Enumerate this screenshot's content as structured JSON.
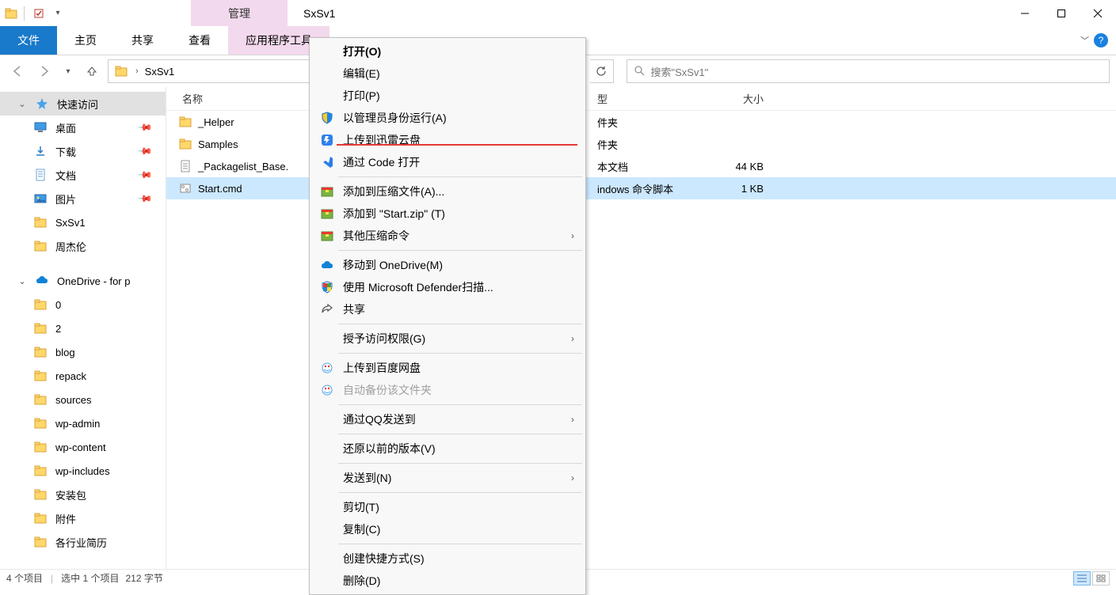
{
  "titlebar": {
    "context_tab": "管理",
    "title": "SxSv1"
  },
  "ribbon": {
    "file": "文件",
    "home": "主页",
    "share": "共享",
    "view": "查看",
    "apptools": "应用程序工具"
  },
  "addr": {
    "path": "SxSv1"
  },
  "search": {
    "placeholder": "搜索\"SxSv1\""
  },
  "sidebar": {
    "quick_access": "快速访问",
    "quick": [
      {
        "label": "桌面",
        "glyph": "monitor"
      },
      {
        "label": "下载",
        "glyph": "download"
      },
      {
        "label": "文档",
        "glyph": "doc"
      },
      {
        "label": "图片",
        "glyph": "picture"
      },
      {
        "label": "SxSv1",
        "glyph": "folder",
        "nopin": true
      },
      {
        "label": "周杰伦",
        "glyph": "folder",
        "nopin": true
      }
    ],
    "onedrive": "OneDrive - for p",
    "onedrive_items": [
      "0",
      "2",
      "blog",
      "repack",
      "sources",
      "wp-admin",
      "wp-content",
      "wp-includes",
      "安装包",
      "附件",
      "各行业简历"
    ]
  },
  "columns": {
    "name": "名称",
    "type": "型",
    "size": "大小"
  },
  "files": [
    {
      "name": "_Helper",
      "type": "件夹",
      "size": "",
      "icon": "folder"
    },
    {
      "name": "Samples",
      "type": "件夹",
      "size": "",
      "icon": "folder"
    },
    {
      "name": "_Packagelist_Base.",
      "type": "本文档",
      "size": "44 KB",
      "icon": "txt"
    },
    {
      "name": "Start.cmd",
      "type": "indows 命令脚本",
      "size": "1 KB",
      "icon": "cmd",
      "selected": true
    }
  ],
  "ctx": [
    {
      "label": "打开(O)",
      "default": true
    },
    {
      "label": "编辑(E)"
    },
    {
      "label": "打印(P)"
    },
    {
      "label": "以管理员身份运行(A)",
      "icon": "shield"
    },
    {
      "label": "上传到迅雷云盘",
      "icon": "xunlei"
    },
    {
      "label": "通过 Code 打开",
      "icon": "vscode"
    },
    {
      "sep": true
    },
    {
      "label": "添加到压缩文件(A)...",
      "icon": "archive"
    },
    {
      "label": "添加到 \"Start.zip\" (T)",
      "icon": "archive"
    },
    {
      "label": "其他压缩命令",
      "icon": "archive",
      "sub": true
    },
    {
      "sep": true
    },
    {
      "label": "移动到 OneDrive(M)",
      "icon": "onedrive"
    },
    {
      "label": "使用 Microsoft Defender扫描...",
      "icon": "defender"
    },
    {
      "label": "共享",
      "icon": "share"
    },
    {
      "sep": true
    },
    {
      "label": "授予访问权限(G)",
      "sub": true
    },
    {
      "sep": true
    },
    {
      "label": "上传到百度网盘",
      "icon": "baidu"
    },
    {
      "label": "自动备份该文件夹",
      "icon": "baidu",
      "disabled": true
    },
    {
      "sep": true
    },
    {
      "label": "通过QQ发送到",
      "sub": true
    },
    {
      "sep": true
    },
    {
      "label": "还原以前的版本(V)"
    },
    {
      "sep": true
    },
    {
      "label": "发送到(N)",
      "sub": true
    },
    {
      "sep": true
    },
    {
      "label": "剪切(T)"
    },
    {
      "label": "复制(C)"
    },
    {
      "sep": true
    },
    {
      "label": "创建快捷方式(S)"
    },
    {
      "label": "删除(D)"
    }
  ],
  "status": {
    "count": "4 个项目",
    "selected": "选中 1 个项目",
    "bytes": "212 字节"
  }
}
